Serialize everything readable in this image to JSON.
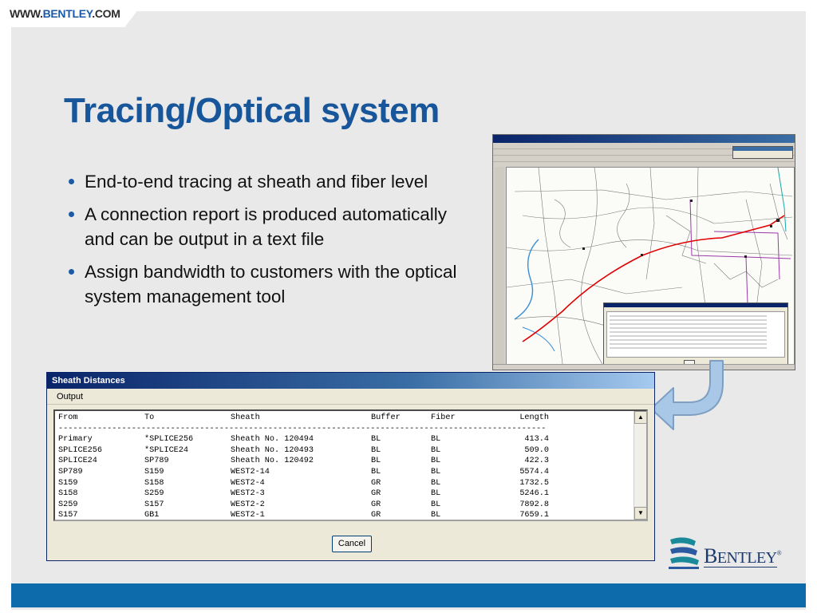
{
  "header": {
    "url_prefix": "WWW.",
    "url_brand": "BENTLEY",
    "url_suffix": ".COM"
  },
  "slide": {
    "title": "Tracing/Optical system",
    "bullets": [
      "End-to-end tracing at sheath and fiber level",
      "A connection report is produced automatically and can be output in a text file",
      "Assign bandwidth to customers with the optical system management tool"
    ]
  },
  "dialog": {
    "title": "Sheath Distances",
    "menu_output": "Output",
    "cancel_label": "Cancel",
    "scroll_up": "▲",
    "scroll_down": "▼",
    "columns": [
      "From",
      "To",
      "Sheath",
      "Buffer",
      "Fiber",
      "Length"
    ],
    "separator": "----------------------------------------------------------------------------------------------------",
    "rows": [
      [
        "Primary",
        "*SPLICE256",
        "Sheath No. 120494",
        "BL",
        "BL",
        "413.4"
      ],
      [
        "SPLICE256",
        "*SPLICE24",
        "Sheath No. 120493",
        "BL",
        "BL",
        "509.0"
      ],
      [
        "SPLICE24",
        "SP789",
        "Sheath No. 120492",
        "BL",
        "BL",
        "422.3"
      ],
      [
        "SP789",
        "S159",
        "WEST2-14",
        "BL",
        "BL",
        "5574.4"
      ],
      [
        "S159",
        "S158",
        "WEST2-4",
        "GR",
        "BL",
        "1732.5"
      ],
      [
        "S158",
        "S259",
        "WEST2-3",
        "GR",
        "BL",
        "5246.1"
      ],
      [
        "S259",
        "S157",
        "WEST2-2",
        "GR",
        "BL",
        "7892.8"
      ],
      [
        "S157",
        "GB1",
        "WEST2-1",
        "GR",
        "BL",
        "7659.1"
      ]
    ]
  },
  "logo": {
    "letter_big": "B",
    "rest": "ENTLEY",
    "mark": "®"
  },
  "colors": {
    "title": "#17569b",
    "band": "#0d6aab",
    "trace": "#e00000"
  }
}
